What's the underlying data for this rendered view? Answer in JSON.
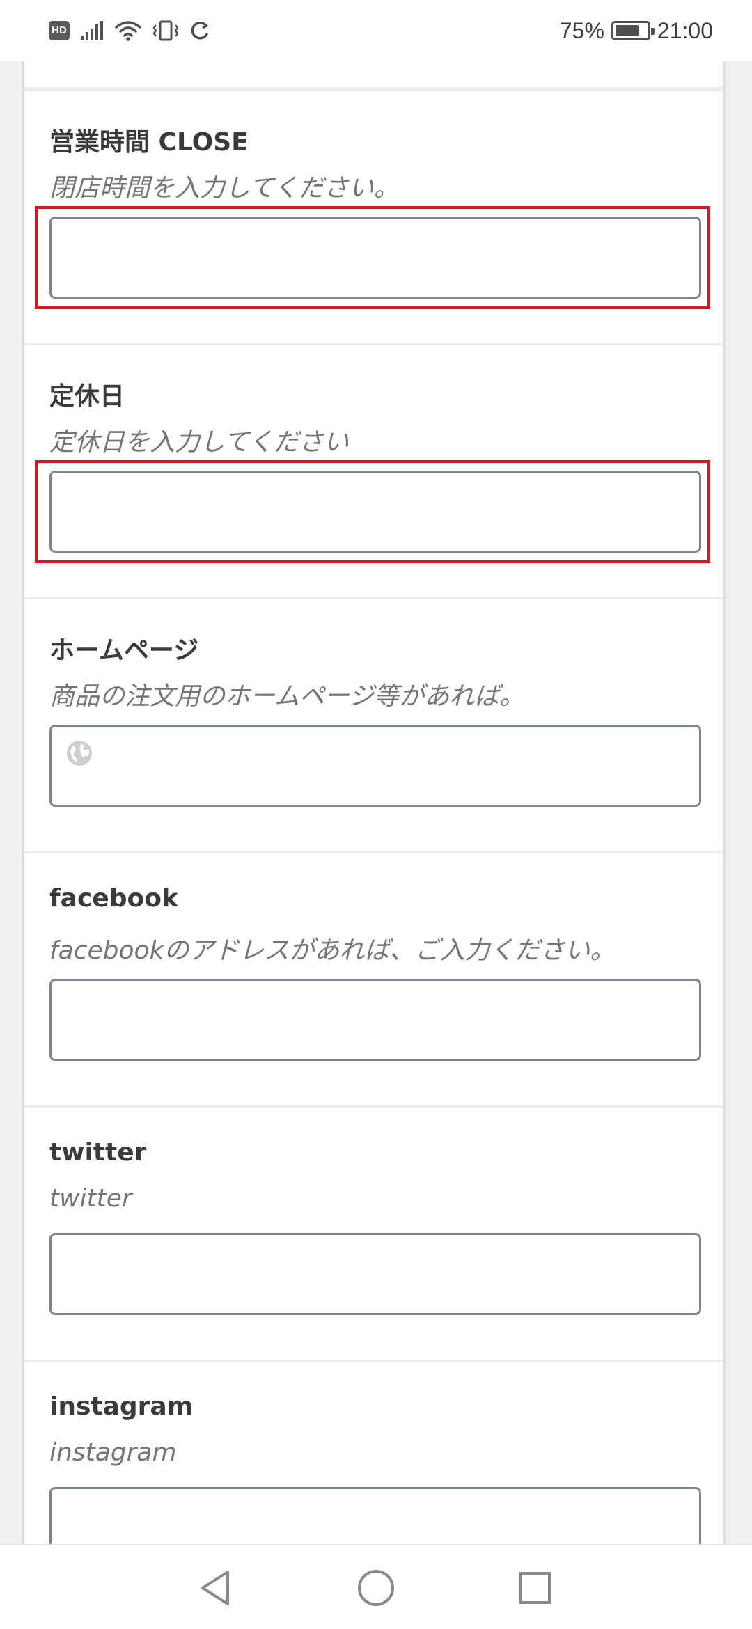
{
  "status_bar": {
    "hd_badge": "HD",
    "battery_percent": "75%",
    "battery_level": 0.75,
    "time": "21:00",
    "icons": [
      "hd-icon",
      "signal-icon",
      "wifi-icon",
      "vibrate-icon",
      "sync-icon",
      "battery-icon"
    ]
  },
  "form": {
    "fields": [
      {
        "label": "営業時間 CLOSE",
        "description": "閉店時間を入力してください。",
        "value": "",
        "highlighted": true
      },
      {
        "label": "定休日",
        "description": "定休日を入力してください",
        "value": "",
        "highlighted": true
      },
      {
        "label": "ホームページ",
        "description": "商品の注文用のホームページ等があれば。",
        "value": "",
        "icon": "globe-icon",
        "highlighted": false
      },
      {
        "label": "facebook",
        "description": "facebookのアドレスがあれば、ご入力ください。",
        "value": "",
        "highlighted": false
      },
      {
        "label": "twitter",
        "description": "twitter",
        "value": "",
        "highlighted": false
      },
      {
        "label": "instagram",
        "description": "instagram",
        "value": "",
        "highlighted": false
      }
    ]
  },
  "nav_bar": {
    "icons": [
      "back-icon",
      "home-icon",
      "recents-icon"
    ]
  },
  "colors": {
    "highlight_border": "#e0141e",
    "input_border": "#7d8590",
    "label_text": "#3a3a3a",
    "description_text": "#757575"
  }
}
